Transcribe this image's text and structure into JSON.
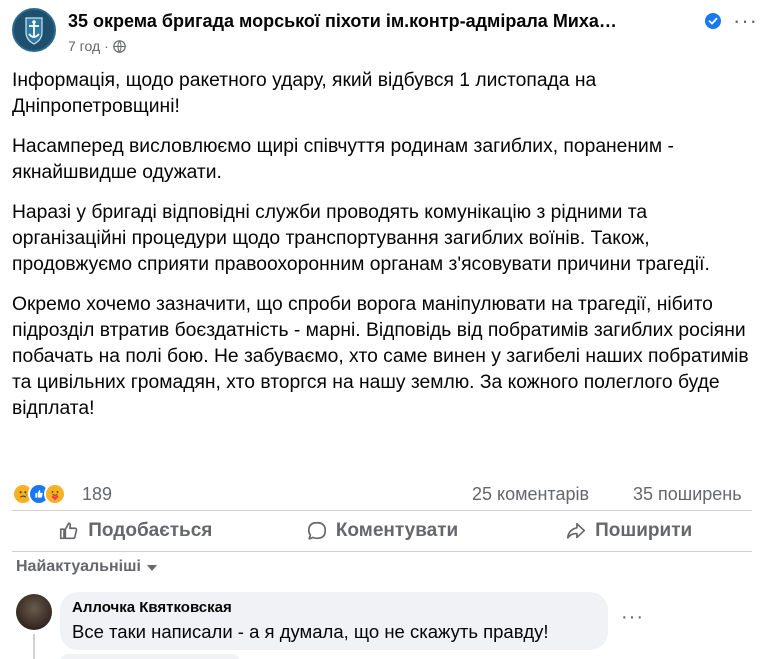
{
  "post": {
    "page_name": "35 окрема бригада морської піхоти ім.контр-адмірала Миха…",
    "time": "7 год",
    "meta_separator": "·",
    "more_label": "···",
    "paragraphs": [
      "Інформація, щодо ракетного удару, який відбувся 1 листопада на Дніпропетровщині!",
      "Насамперед висловлюємо щирі співчуття родинам загиблих, пораненим - якнайшвидше одужати.",
      "Наразі у бригаді відповідні служби проводять комунікацію з рідними та організаційні процедури щодо транспортування загиблих воїнів. Також, продовжуємо сприяти правоохоронним органам з'ясовувати причини трагедії.",
      "Окремо хочемо зазначити, що спроби ворога маніпулювати на трагедії, нібито підрозділ втратив боєздатність - марні. Відповідь від побратимів загиблих росіяни побачать на полі бою. Не забуваємо, хто саме винен у загибелі наших побратимів та цивільних громадян, хто вторгся на нашу землю. За кожного полеглого буде відплата!"
    ]
  },
  "stats": {
    "reactions": "189",
    "comments": "25 коментарів",
    "shares": "35 поширень",
    "reaction_icons": [
      "sad-icon",
      "like-icon",
      "care-icon"
    ]
  },
  "actions": {
    "like": "Подобається",
    "comment": "Коментувати",
    "share": "Поширити"
  },
  "sort": {
    "label": "Найактуальніші"
  },
  "comment": {
    "author": "Аллочка Квятковская",
    "text": "Все таки написали - а я думала, що не скажуть правду!",
    "more_label": "···"
  },
  "colors": {
    "verified": "#1877f2",
    "secondary_text": "#65676b",
    "bubble_bg": "#f0f2f5"
  }
}
